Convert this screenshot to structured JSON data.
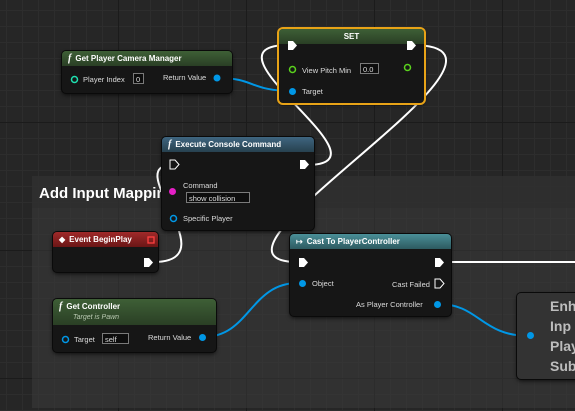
{
  "comment": {
    "title": "Add Input Mapping"
  },
  "nodes": {
    "camera": {
      "title": "Get Player Camera Manager",
      "player_index_label": "Player Index",
      "player_index_value": "0",
      "return_label": "Return Value"
    },
    "set": {
      "title": "SET",
      "view_pitch_label": "View Pitch Min",
      "view_pitch_value": "0.0",
      "target_label": "Target"
    },
    "console": {
      "title": "Execute Console Command",
      "command_label": "Command",
      "command_value": "show collision",
      "specific_player_label": "Specific Player"
    },
    "begin_play": {
      "title": "Event BeginPlay"
    },
    "cast": {
      "title": "Cast To PlayerController",
      "object_label": "Object",
      "cast_failed_label": "Cast Failed",
      "as_pc_label": "As Player Controller"
    },
    "get_controller": {
      "title": "Get Controller",
      "subtitle": "Target is Pawn",
      "target_label": "Target",
      "target_value": "self",
      "return_label": "Return Value"
    },
    "enhanced": {
      "lines": [
        "Enh",
        "Inp",
        "Play",
        "Sub"
      ]
    }
  },
  "colors": {
    "exec": "#ffffff",
    "object": "#0097e6",
    "float": "#5ad21d",
    "string": "#e51fc6",
    "selection": "#e8a317"
  }
}
